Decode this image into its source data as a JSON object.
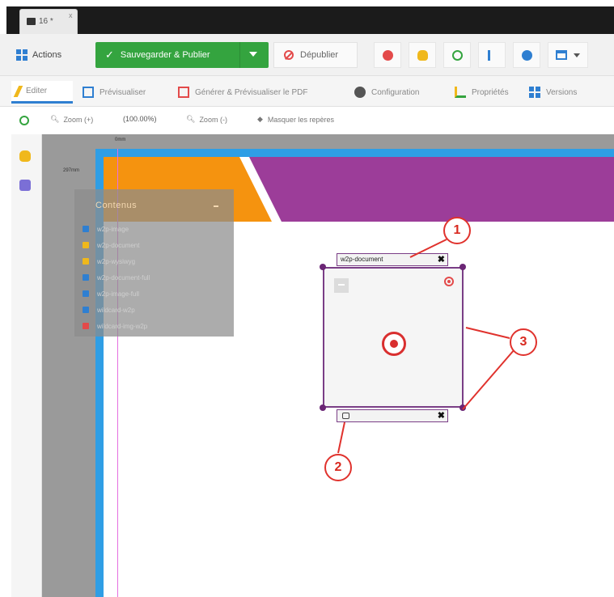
{
  "window": {
    "tab_label": "16 *",
    "tab_close": "x"
  },
  "toolbar": {
    "actions_label": "Actions",
    "save_publish_label": "Sauvegarder & Publier",
    "unpublish_label": "Dépublier",
    "icon_buttons": [
      {
        "name": "delete-icon",
        "color": "#e34a4a"
      },
      {
        "name": "lightbulb-icon",
        "color": "#f0b81c"
      },
      {
        "name": "refresh-icon",
        "color": "#34a43f"
      },
      {
        "name": "tree-icon",
        "color": "#2f7fd1"
      },
      {
        "name": "info-icon",
        "color": "#2f7fd1"
      },
      {
        "name": "layout-icon",
        "color": "#2f7fd1"
      }
    ]
  },
  "editor_tabs": [
    {
      "label": "Editer",
      "active": true,
      "icon": "pencil-icon",
      "color": "#f0b81c"
    },
    {
      "label": "Prévisualiser",
      "active": false,
      "icon": "preview-icon",
      "color": "#2f7fd1"
    },
    {
      "label": "Générer & Prévisualiser le PDF",
      "active": false,
      "icon": "pdf-icon",
      "color": "#e34a4a"
    },
    {
      "label": "Configuration",
      "active": false,
      "icon": "gear-icon",
      "color": "#555555"
    },
    {
      "label": "Propriétés",
      "active": false,
      "icon": "properties-icon",
      "color": "#34a43f"
    },
    {
      "label": "Versions",
      "active": false,
      "icon": "versions-icon",
      "color": "#2f7fd1"
    }
  ],
  "zoom_bar": {
    "zoom_in_label": "Zoom (+)",
    "zoom_value": "(100.00%)",
    "zoom_out_label": "Zoom (-)",
    "hide_guides_label": "Masquer les repères"
  },
  "rulers": {
    "top_label": "0mm",
    "left_label": "297mm"
  },
  "contents_panel": {
    "title": "Contenus",
    "items": [
      {
        "label": "w2p-image",
        "color": "#2f7fd1"
      },
      {
        "label": "w2p-document",
        "color": "#f0b81c"
      },
      {
        "label": "w2p-wysiwyg",
        "color": "#f0b81c"
      },
      {
        "label": "w2p-document-full",
        "color": "#2f7fd1"
      },
      {
        "label": "w2p-image-full",
        "color": "#2f7fd1"
      },
      {
        "label": "wildcard-w2p",
        "color": "#2f7fd1"
      },
      {
        "label": "wildcard-img-w2p",
        "color": "#e34a4a"
      }
    ]
  },
  "component": {
    "top_label": "w2p-document",
    "close": "✖"
  },
  "callouts": [
    "1",
    "2",
    "3"
  ],
  "colors": {
    "banner_orange": "#f5930f",
    "banner_purple": "#9c3d99",
    "frame_purple": "#7a3e86",
    "callout_red": "#e0322d",
    "guide_blue": "#2f9ee5"
  }
}
